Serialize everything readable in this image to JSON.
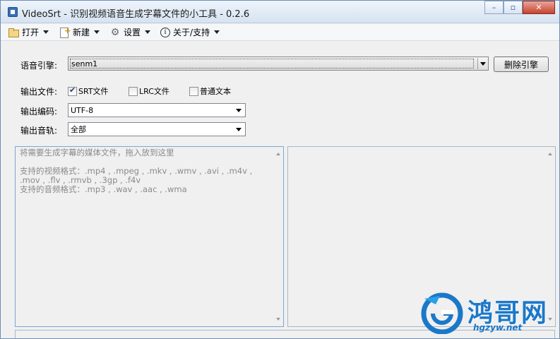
{
  "window": {
    "title": "VideoSrt - 识别视频语音生成字幕文件的小工具 - 0.2.6",
    "controls": {
      "minimize": "–",
      "maximize": "▫",
      "close": "✕"
    }
  },
  "menu": {
    "open": "打开",
    "new": "新建",
    "settings": "设置",
    "about": "关于/支持",
    "about_icon_glyph": "i"
  },
  "form": {
    "engine": {
      "label": "语音引擎:",
      "value": "senm1",
      "delete_button": "删除引擎"
    },
    "output_file": {
      "label": "输出文件:",
      "options": [
        {
          "label": "SRT文件",
          "checked": true
        },
        {
          "label": "LRC文件",
          "checked": false
        },
        {
          "label": "普通文本",
          "checked": false
        }
      ]
    },
    "encoding": {
      "label": "输出编码:",
      "value": "UTF-8"
    },
    "track": {
      "label": "输出音轨:",
      "value": "全部"
    }
  },
  "drop_panel": {
    "hint": "将需要生成字幕的媒体文件，拖入放到这里",
    "video_formats": "支持的视频格式：.mp4 , .mpeg , .mkv , .wmv , .avi , .m4v , .mov , .flv , .rmvb , .3gp , .f4v",
    "audio_formats": "支持的音频格式：.mp3 , .wav , .aac , .wma"
  },
  "watermark": {
    "name": "鸿哥网",
    "url": "hgzyw.net"
  },
  "colors": {
    "accent": "#1b78c9",
    "frame": "#6d8eb5",
    "hint_text": "#8a8a8a"
  }
}
